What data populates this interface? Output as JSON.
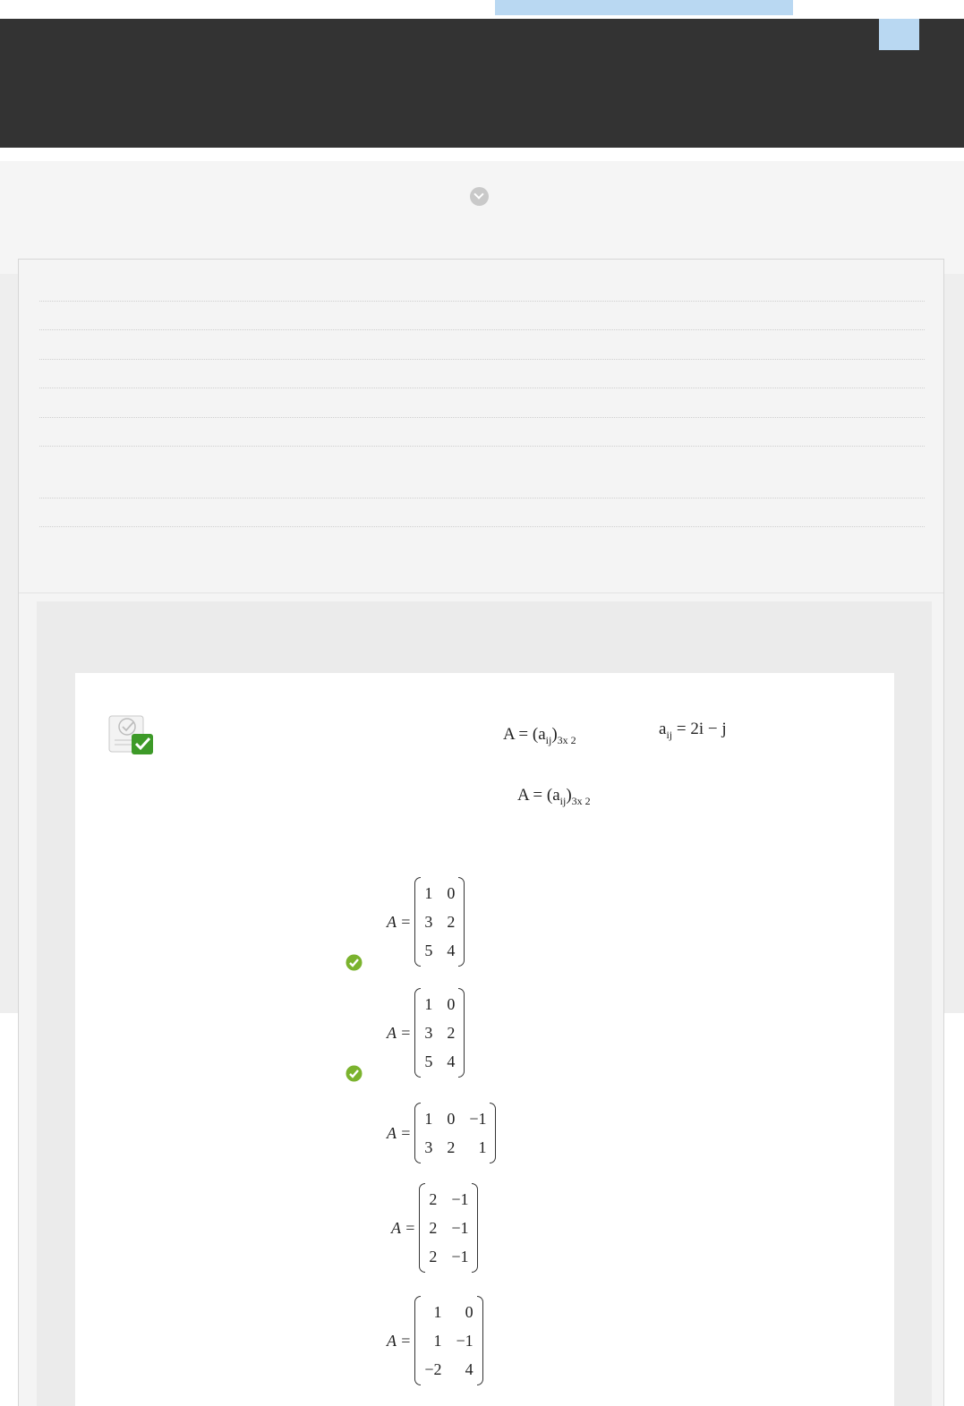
{
  "header": {
    "bg_color": "#333333",
    "accent": "#b9d8f2"
  },
  "question": {
    "icon": "quiz-check-icon",
    "formula_a": {
      "lhs": "A = (a",
      "sub1": "ij",
      "mid": ")",
      "sub2": "3x 2"
    },
    "formula_rule": {
      "lhs": "a",
      "sub": "ij",
      "rhs": " = 2i − j"
    },
    "formula_b": {
      "lhs": "A = (a",
      "sub1": "ij",
      "mid": ")",
      "sub2": "3x 2"
    }
  },
  "options": [
    {
      "lhs": "A =",
      "rows": [
        [
          "1",
          "0"
        ],
        [
          "3",
          "2"
        ],
        [
          "5",
          "4"
        ]
      ],
      "correct": true
    },
    {
      "lhs": "A =",
      "rows": [
        [
          "1",
          "0"
        ],
        [
          "3",
          "2"
        ],
        [
          "5",
          "4"
        ]
      ],
      "correct": true
    },
    {
      "lhs": "A =",
      "rows": [
        [
          "1",
          "0",
          "−1"
        ],
        [
          "3",
          "2",
          "1"
        ]
      ],
      "correct": false
    },
    {
      "lhs": "A =",
      "rows": [
        [
          "2",
          "−1"
        ],
        [
          "2",
          "−1"
        ],
        [
          "2",
          "−1"
        ]
      ],
      "correct": false
    },
    {
      "lhs": "A =",
      "rows": [
        [
          "1",
          "0"
        ],
        [
          "1",
          "−1"
        ],
        [
          "−2",
          "4"
        ]
      ],
      "correct": false
    }
  ]
}
